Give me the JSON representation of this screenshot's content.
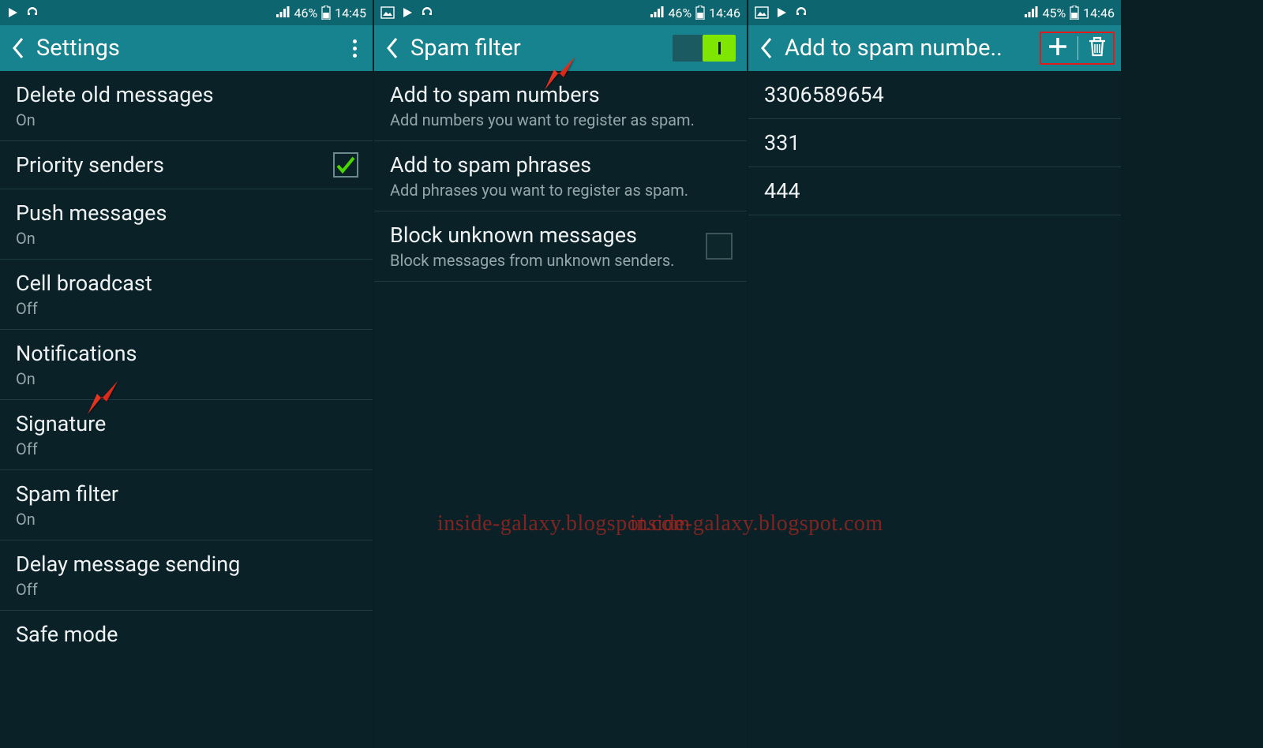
{
  "watermark": "inside-galaxy.blogspot.com",
  "screen1": {
    "status": {
      "battery_pct": "46%",
      "time": "14:45"
    },
    "title": "Settings",
    "rows": [
      {
        "title": "Delete old messages",
        "sub": "On"
      },
      {
        "title": "Priority senders"
      },
      {
        "title": "Push messages",
        "sub": "On"
      },
      {
        "title": "Cell broadcast",
        "sub": "Off"
      },
      {
        "title": "Notifications",
        "sub": "On"
      },
      {
        "title": "Signature",
        "sub": "Off"
      },
      {
        "title": "Spam filter",
        "sub": "On"
      },
      {
        "title": "Delay message sending",
        "sub": "Off"
      },
      {
        "title": "Safe mode"
      }
    ]
  },
  "screen2": {
    "status": {
      "battery_pct": "46%",
      "time": "14:46"
    },
    "title": "Spam filter",
    "rows": [
      {
        "title": "Add to spam numbers",
        "sub": "Add numbers you want to register as spam."
      },
      {
        "title": "Add to spam phrases",
        "sub": "Add phrases you want to register as spam."
      },
      {
        "title": "Block unknown messages",
        "sub": "Block messages from unknown senders."
      }
    ]
  },
  "screen3": {
    "status": {
      "battery_pct": "45%",
      "time": "14:46"
    },
    "title": "Add to spam numbe..",
    "numbers": [
      "3306589654",
      "331",
      "444"
    ]
  }
}
